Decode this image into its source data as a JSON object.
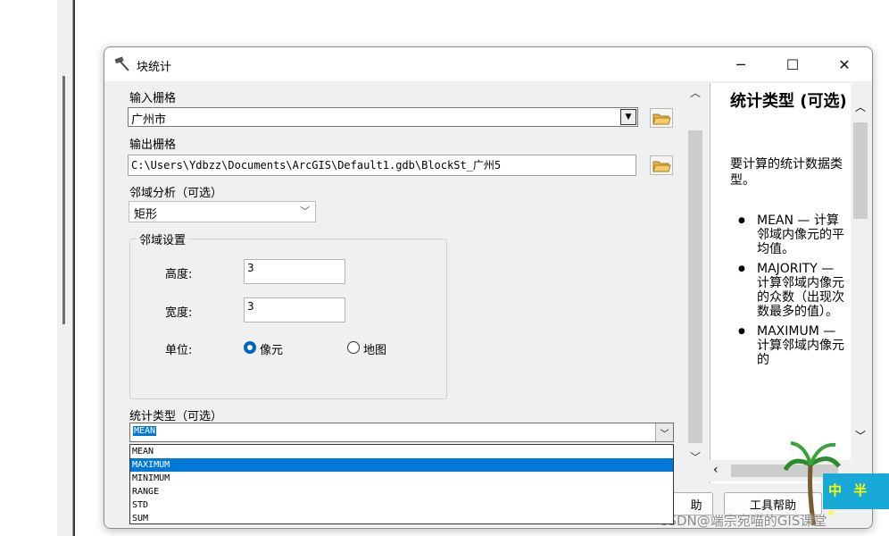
{
  "window": {
    "title": "块统计",
    "icon": "hammer-icon"
  },
  "form": {
    "input_raster_label": "输入栅格",
    "input_raster_value": "广州市",
    "output_raster_label": "输出栅格",
    "output_raster_value": "C:\\Users\\Ydbzz\\Documents\\ArcGIS\\Default1.gdb\\BlockSt_广州5",
    "neighborhood_label": "邻域分析（可选）",
    "neighborhood_value": "矩形",
    "settings_title": "邻域设置",
    "height_label": "高度:",
    "height_value": "3",
    "width_label": "宽度:",
    "width_value": "3",
    "unit_label": "单位:",
    "unit_options": [
      "像元",
      "地图"
    ],
    "unit_selected": "像元",
    "stat_type_label": "统计类型（可选）",
    "stat_type_value": "MEAN",
    "stat_options": [
      "MEAN",
      "MAXIMUM",
      "MINIMUM",
      "RANGE",
      "STD",
      "SUM"
    ],
    "stat_highlighted": "MAXIMUM"
  },
  "buttons": {
    "partial_help": "助",
    "tool_help": "工具帮助"
  },
  "help": {
    "title": "统计类型 (可选)",
    "intro": "要计算的统计数据类型。",
    "items": [
      "MEAN — 计算邻域内像元的平均值。",
      "MAJORITY — 计算邻域内像元的众数（出现次数最多的值）。",
      "MAXIMUM — 计算邻域内像元的"
    ]
  },
  "watermark": "CSDN@端宗宛喵的GIS课堂",
  "logo_text": "中 半 。"
}
